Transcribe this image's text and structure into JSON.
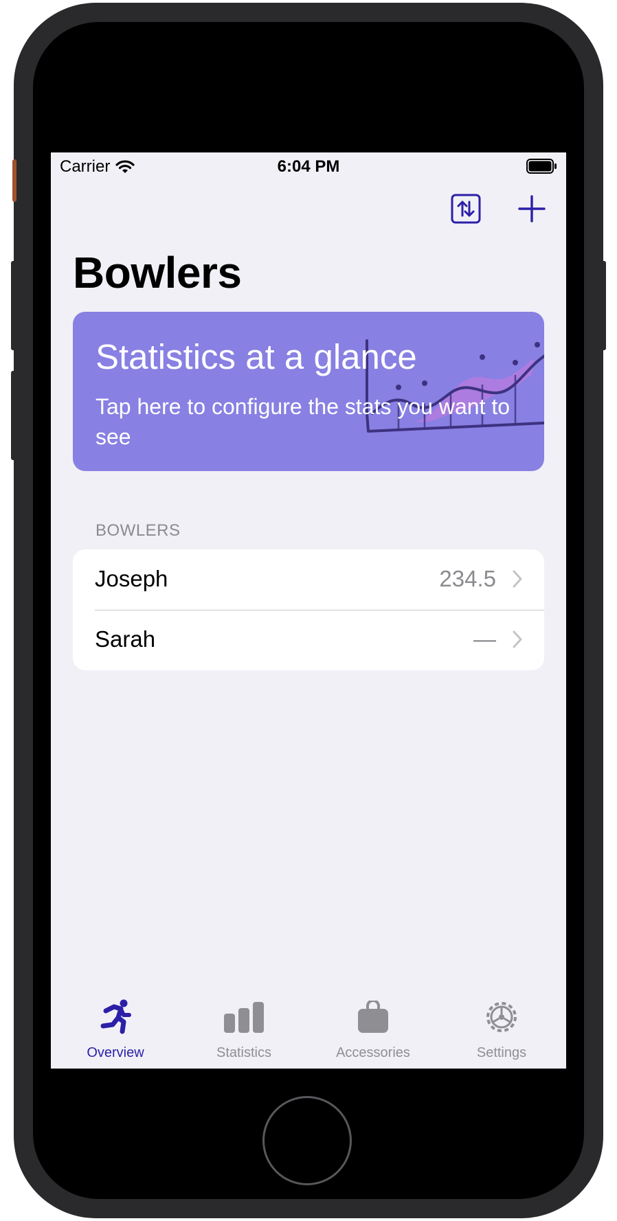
{
  "status_bar": {
    "carrier": "Carrier",
    "time": "6:04 PM"
  },
  "nav": {
    "title": "Bowlers",
    "sort_icon": "sort-swap-icon",
    "add_icon": "plus-icon"
  },
  "banner": {
    "title": "Statistics at a glance",
    "subtitle": "Tap here to configure the stats you want to see",
    "art_icon": "line-chart-illustration"
  },
  "bowlers_section": {
    "header": "BOWLERS",
    "rows": [
      {
        "name": "Joseph",
        "value": "234.5"
      },
      {
        "name": "Sarah",
        "value": "—"
      }
    ]
  },
  "tab_bar": {
    "tabs": [
      {
        "label": "Overview",
        "icon": "running-person-icon",
        "selected": true
      },
      {
        "label": "Statistics",
        "icon": "bar-chart-icon",
        "selected": false
      },
      {
        "label": "Accessories",
        "icon": "bag-icon",
        "selected": false
      },
      {
        "label": "Settings",
        "icon": "gear-icon",
        "selected": false
      }
    ]
  },
  "colors": {
    "accent": "#2c1fa8",
    "banner_bg": "#8880e2",
    "background": "#f1f0f6",
    "secondary_text": "#8a8a8f",
    "inactive_tab": "#8e8e93"
  }
}
